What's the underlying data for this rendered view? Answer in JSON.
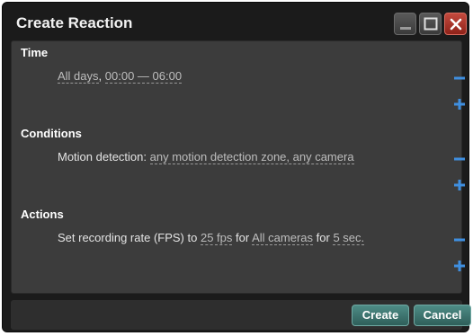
{
  "dialog": {
    "title": "Create Reaction"
  },
  "time": {
    "header": "Time",
    "days": "All days",
    "sep": ",",
    "range": "00:00 — 06:00"
  },
  "conditions": {
    "header": "Conditions",
    "prefix": "Motion detection:",
    "value": "any motion detection zone, any camera"
  },
  "actions": {
    "header": "Actions",
    "prefix": "Set recording rate (FPS) to",
    "fps": "25 fps",
    "for1": "for",
    "cameras": "All cameras",
    "for2": "for",
    "duration": "5 sec."
  },
  "buttons": {
    "create": "Create",
    "cancel": "Cancel"
  },
  "icons": {
    "minimize": "minimize-icon",
    "maximize": "maximize-icon",
    "close": "close-icon",
    "remove": "minus-icon",
    "add": "plus-icon"
  },
  "colors": {
    "accent": "#4e8c86",
    "control": "#3f8fe0",
    "close": "#b8392d"
  }
}
